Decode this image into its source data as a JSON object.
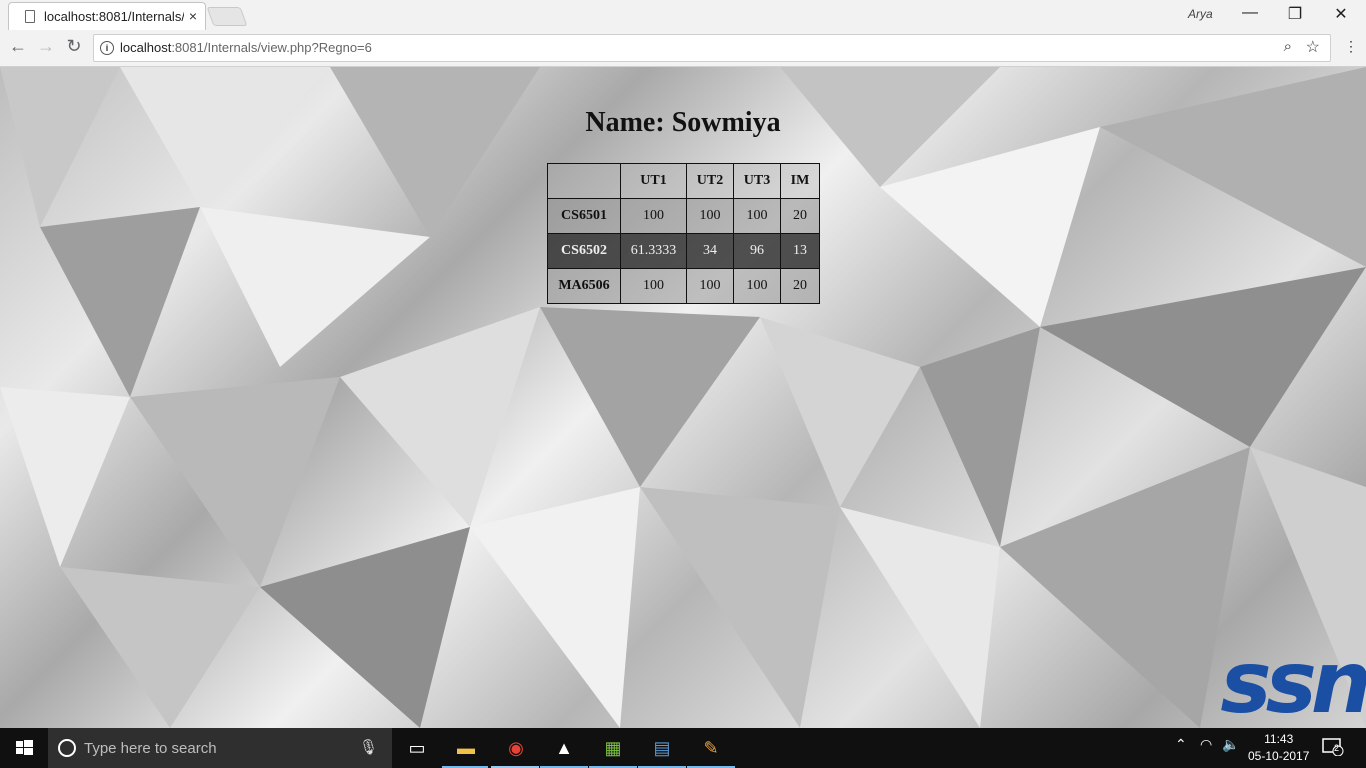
{
  "browser": {
    "tab_title": "localhost:8081/Internals/",
    "tab_close": "×",
    "profile_name": "Arya",
    "window_controls": {
      "minimize": "—",
      "restore": "❐",
      "close": "✕"
    },
    "nav": {
      "back": "←",
      "forward": "→",
      "reload": "↻"
    },
    "address": {
      "host": "localhost",
      "path": ":8081/Internals/view.php?Regno=6"
    },
    "menu": "⋮",
    "zoom": "⌕",
    "star": "☆"
  },
  "page": {
    "heading": "Name: Sowmiya",
    "table": {
      "headers": [
        "",
        "UT1",
        "UT2",
        "UT3",
        "IM"
      ],
      "rows": [
        {
          "subject": "CS6501",
          "ut1": "100",
          "ut2": "100",
          "ut3": "100",
          "im": "20"
        },
        {
          "subject": "CS6502",
          "ut1": "61.3333",
          "ut2": "34",
          "ut3": "96",
          "im": "13"
        },
        {
          "subject": "MA6506",
          "ut1": "100",
          "ut2": "100",
          "ut3": "100",
          "im": "20"
        }
      ]
    },
    "logo_text": "ssn"
  },
  "taskbar": {
    "search_placeholder": "Type here to search",
    "time": "11:43",
    "date": "05-10-2017",
    "notification_count": "2"
  },
  "colors": {
    "logo": "#1a4fa3",
    "taskbar": "#101010",
    "active_underline": "#76b9ed"
  }
}
